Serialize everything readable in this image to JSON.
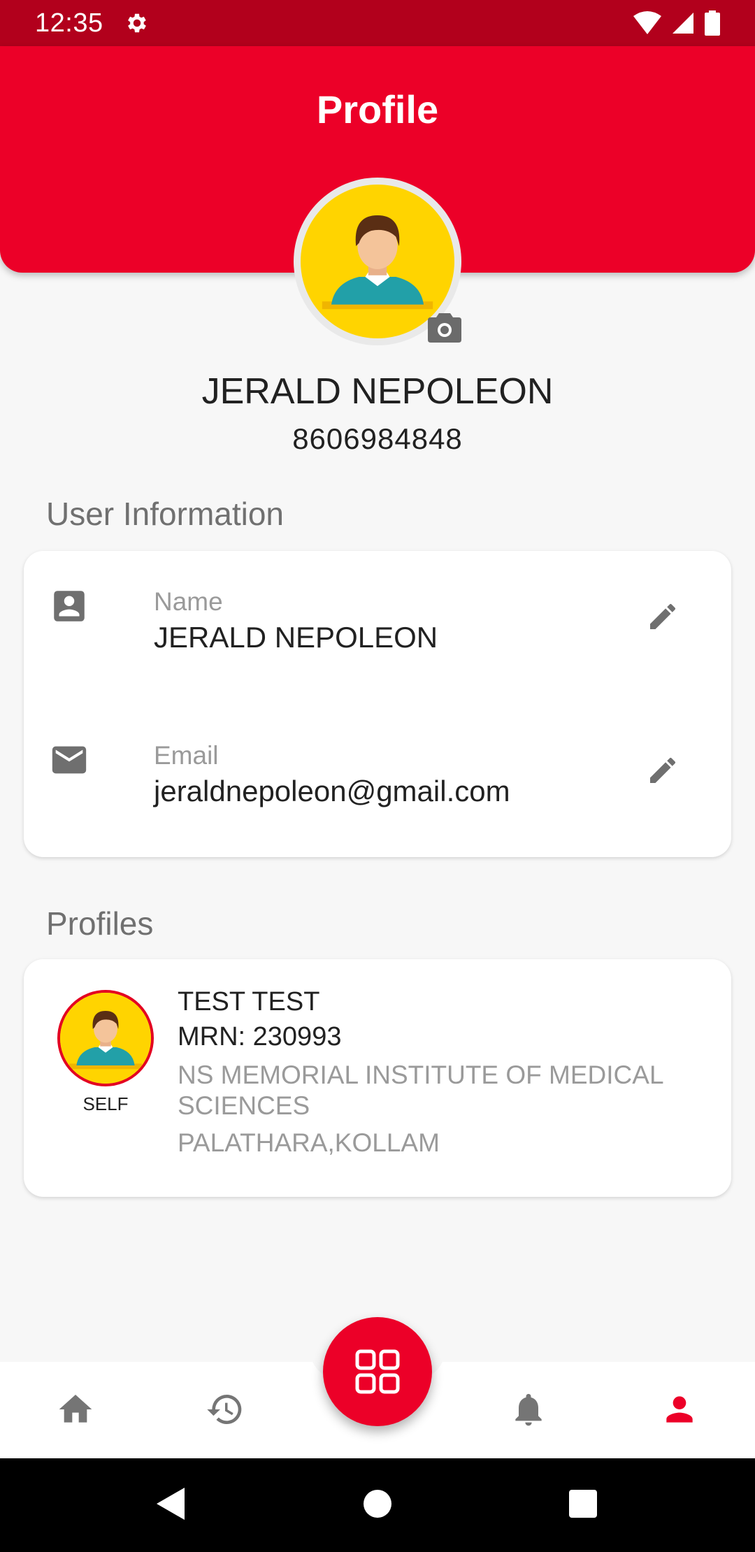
{
  "status_bar": {
    "time": "12:35"
  },
  "header": {
    "title": "Profile"
  },
  "profile": {
    "name": "JERALD NEPOLEON",
    "phone": "8606984848"
  },
  "user_information": {
    "section_title": "User Information",
    "fields": [
      {
        "label": "Name",
        "value": "JERALD NEPOLEON",
        "icon": "account-box-icon"
      },
      {
        "label": "Email",
        "value": "jeraldnepoleon@gmail.com",
        "icon": "email-icon"
      }
    ]
  },
  "profiles": {
    "section_title": "Profiles",
    "items": [
      {
        "relation": "SELF",
        "name": "TEST TEST",
        "mrn": "MRN: 230993",
        "hospital": "NS MEMORIAL INSTITUTE OF MEDICAL SCIENCES",
        "place": "PALATHARA,KOLLAM"
      }
    ]
  },
  "bottom_nav": {
    "items": [
      "home-icon",
      "history-icon",
      "apps-grid-icon",
      "bell-icon",
      "person-icon"
    ],
    "active": "person-icon"
  },
  "colors": {
    "primary": "#ec0028",
    "status_bar": "#b2001c",
    "background": "#f7f7f7",
    "muted_text": "#9a9a9a",
    "icon_gray": "#6f6f6f"
  }
}
